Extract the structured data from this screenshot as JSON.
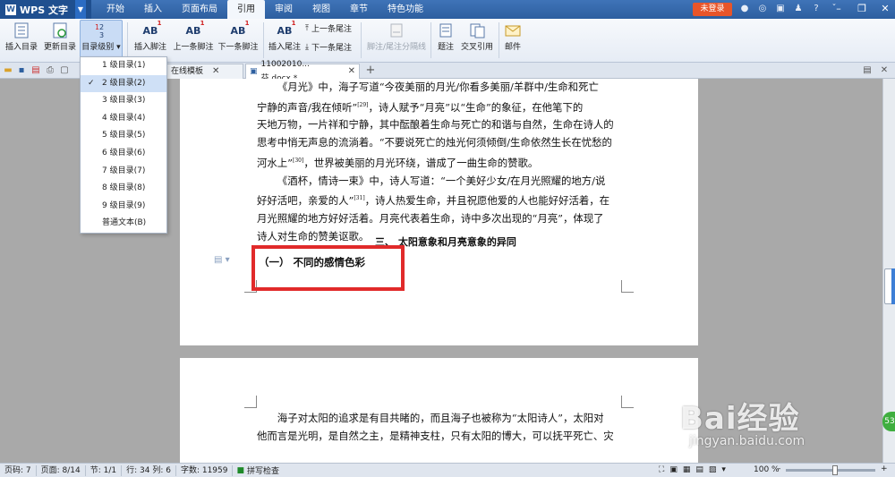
{
  "titlebar": {
    "app_name": "WPS 文字",
    "logo_letter": "W",
    "menu_tabs": [
      "开始",
      "插入",
      "页面布局",
      "引用",
      "审阅",
      "视图",
      "章节",
      "特色功能"
    ],
    "active_tab": "引用",
    "login_label": "未登录"
  },
  "ribbon": {
    "insert_toc": "插入目录",
    "update_toc": "更新目录",
    "toc_level": "目录级别",
    "insert_footnote": "插入脚注",
    "prev_footnote": "上一条脚注",
    "next_footnote": "下一条脚注",
    "insert_endnote": "插入尾注",
    "prev_endnote": "上一条尾注",
    "next_endnote": "下一条尾注",
    "footnote_separator": "脚注/尾注分隔线",
    "caption": "题注",
    "cross_reference": "交叉引用",
    "mail": "邮件",
    "ab_label": "AB",
    "ab_sup": "1"
  },
  "tabs": [
    {
      "label": "在线模板"
    },
    {
      "label": "11002010...芬.docx *"
    }
  ],
  "dropdown": {
    "items": [
      "1 级目录(1)",
      "2 级目录(2)",
      "3 级目录(3)",
      "4 级目录(4)",
      "5 级目录(5)",
      "6 级目录(6)",
      "7 级目录(7)",
      "8 级目录(8)",
      "9 级目录(9)",
      "普通文本(B)"
    ],
    "selected_index": 1
  },
  "document": {
    "p1_lines": [
      "《月光》中，海子写道“今夜美丽的月光/你看多美丽/羊群中/生命和死亡",
      "宁静的声音/我在倾听”",
      "，诗人赋予“月亮”以“生命”的象征，在他笔下的",
      "天地万物，一片祥和宁静，其中酝酿着生命与死亡的和谐与自然，生命在诗人的",
      "思考中悄无声息的流淌着。“不要说死亡的烛光何须倾倒/生命依然生长在忧愁的",
      "河水上”",
      "，世界被美丽的月光环绕，谱成了一曲生命的赞歌。"
    ],
    "cite_29": "[29]",
    "cite_30": "[30]",
    "cite_31": "[31]",
    "p2_a": "《酒杯，情诗一束》中，诗人写道：“一个美好少女/在月光照耀的地方/说",
    "p2_b": "好好活吧，亲爱的人”",
    "p2_c": "，诗人热爱生命，并且祝愿他爱的人也能好好活着，在",
    "p2_d": "月光照耀的地方好好活着。月亮代表着生命，诗中多次出现的“月亮”，体现了",
    "p2_e": "诗人对生命的赞美讴歌。",
    "section_heading": "三、 太阳意象和月亮意象的异同",
    "sub_heading": "（一） 不同的感情色彩",
    "page2_line1": "海子对太阳的追求是有目共睹的，而且海子也被称为“太阳诗人”，太阳对",
    "page2_line2": "他而言是光明，是自然之主，是精神支柱，只有太阳的博大，可以抚平死亡、灾"
  },
  "statusbar": {
    "page_code": "页码: 7",
    "page": "页面: 8/14",
    "section": "节: 1/1",
    "row_col": "行: 34  列: 6",
    "word_count": "字数: 11959",
    "spell_check": "拼写检查",
    "zoom": "100 %",
    "zoom_fraction": 0.55
  },
  "watermark": {
    "logo": "Bai经验",
    "url": "jingyan.baidu.com",
    "badge": "53"
  },
  "colors": {
    "accent": "#2d5f9f",
    "login": "#e8552a",
    "highlight": "#e12a2a"
  }
}
